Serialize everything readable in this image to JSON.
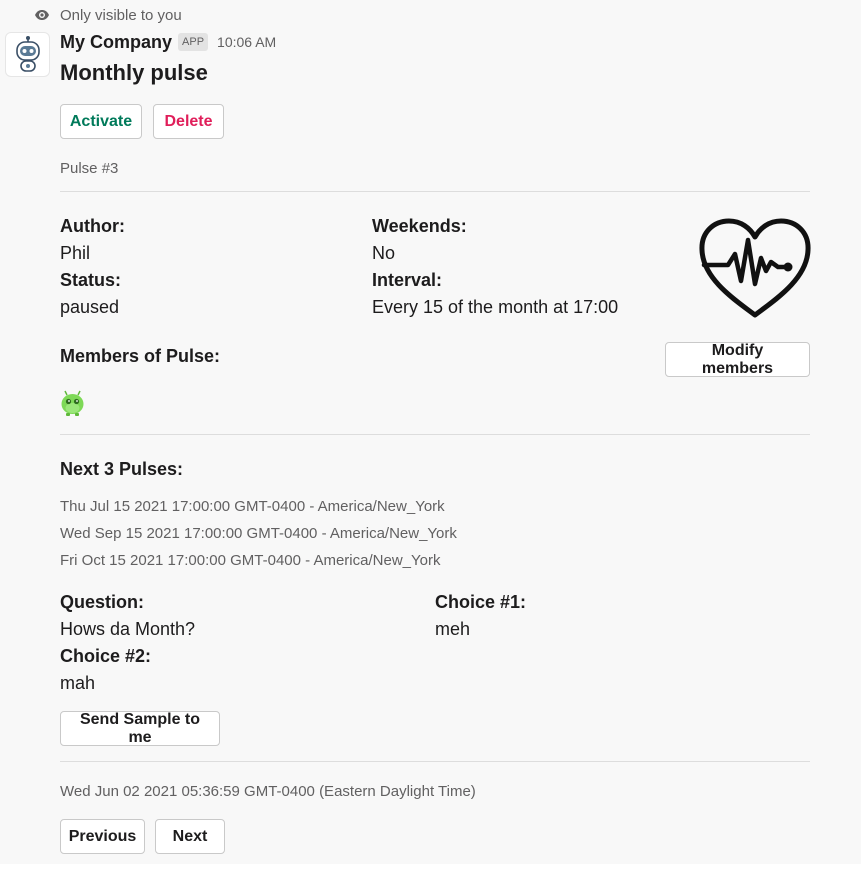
{
  "ephemeral_note": "Only visible to you",
  "sender": {
    "name": "My Company",
    "badge": "APP",
    "time": "10:06 AM"
  },
  "title": "Monthly pulse",
  "actions": {
    "activate": "Activate",
    "delete": "Delete"
  },
  "pulse_id": "Pulse #3",
  "details": {
    "author_label": "Author:",
    "author_value": "Phil",
    "status_label": "Status:",
    "status_value": "paused",
    "weekends_label": "Weekends:",
    "weekends_value": "No",
    "interval_label": "Interval:",
    "interval_value": "Every 15 of the month at 17:00"
  },
  "members": {
    "label": "Members of Pulse:",
    "modify_button": "Modify members"
  },
  "next_pulses": {
    "label": "Next 3 Pulses:",
    "items": [
      "Thu Jul 15 2021 17:00:00 GMT-0400 - America/New_York",
      "Wed Sep 15 2021 17:00:00 GMT-0400 - America/New_York",
      "Fri Oct 15 2021 17:00:00 GMT-0400 - America/New_York"
    ]
  },
  "question": {
    "question_label": "Question:",
    "question_value": "Hows da Month?",
    "choice1_label": "Choice #1:",
    "choice1_value": "meh",
    "choice2_label": "Choice #2:",
    "choice2_value": "mah"
  },
  "send_sample_button": "Send Sample to me",
  "footer_timestamp": "Wed Jun 02 2021 05:36:59 GMT-0400 (Eastern Daylight Time)",
  "pagination": {
    "previous": "Previous",
    "next": "Next"
  },
  "colors": {
    "activate": "#007a5a",
    "delete": "#e01e5a",
    "member_avatar": "#7ed957"
  },
  "icons": [
    "eye-icon",
    "bot-avatar-icon",
    "heartbeat-icon",
    "member-avatar-icon"
  ]
}
